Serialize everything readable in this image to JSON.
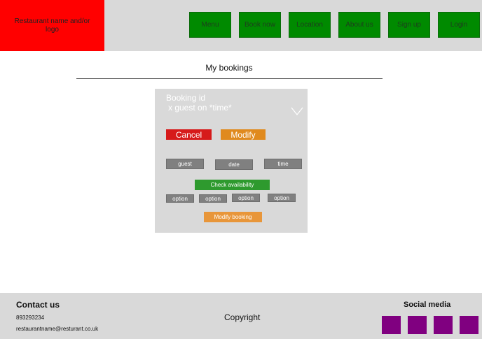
{
  "header": {
    "logo_text": "Restaurant name and/or logo",
    "nav": [
      {
        "label": "Menu"
      },
      {
        "label": "Book now"
      },
      {
        "label": "Location"
      },
      {
        "label": "About us"
      },
      {
        "label": "Sign up"
      },
      {
        "label": "Login"
      }
    ]
  },
  "page": {
    "title": "My bookings"
  },
  "booking_card": {
    "booking_id": "Booking id",
    "summary": "x guest on *time*",
    "chevron_icon": "chevron-down-icon",
    "cancel_label": "Cancel",
    "modify_label": "Modify",
    "fields": {
      "guest": "guest",
      "date": "date",
      "time": "time"
    },
    "check_availability_label": "Check availability",
    "options": [
      "option",
      "option",
      "option",
      "option"
    ],
    "modify_booking_label": "Modify booking"
  },
  "footer": {
    "contact_title": "Contact us",
    "phone": "893293234",
    "email": "restaurantname@resturant.co.uk",
    "copyright": "Copyright",
    "social_title": "Social media",
    "social_icons": [
      "social-icon",
      "social-icon",
      "social-icon",
      "social-icon"
    ]
  },
  "colors": {
    "header_bg": "#d9d9d9",
    "logo_bg": "#ff0000",
    "nav_bg": "#008a00",
    "cancel": "#d61a1a",
    "modify": "#e08a1e",
    "check": "#2e9a2e",
    "social": "#800080"
  }
}
